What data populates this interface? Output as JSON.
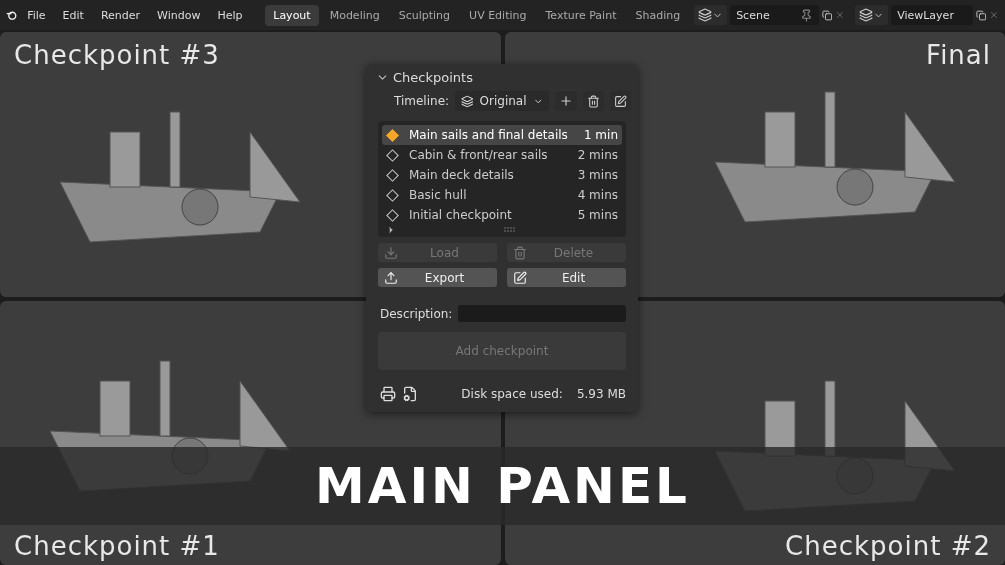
{
  "menu": [
    "File",
    "Edit",
    "Render",
    "Window",
    "Help"
  ],
  "workspaces": [
    {
      "label": "Layout",
      "selected": true
    },
    {
      "label": "Modeling",
      "selected": false
    },
    {
      "label": "Sculpting",
      "selected": false
    },
    {
      "label": "UV Editing",
      "selected": false
    },
    {
      "label": "Texture Paint",
      "selected": false
    },
    {
      "label": "Shading",
      "selected": false
    }
  ],
  "scene": "Scene",
  "view_layer": "ViewLayer",
  "viewports": [
    {
      "label": "Checkpoint #3"
    },
    {
      "label": "Final"
    },
    {
      "label": "Checkpoint #1"
    },
    {
      "label": "Checkpoint #2"
    }
  ],
  "panel": {
    "title": "Checkpoints",
    "timeline_label": "Timeline:",
    "timeline_value": "Original",
    "checkpoints": [
      {
        "name": "Main sails and final details",
        "time": "1 min",
        "selected": true
      },
      {
        "name": "Cabin & front/rear sails",
        "time": "2 mins",
        "selected": false
      },
      {
        "name": "Main deck details",
        "time": "3 mins",
        "selected": false
      },
      {
        "name": "Basic hull",
        "time": "4 mins",
        "selected": false
      },
      {
        "name": "Initial checkpoint",
        "time": "5 mins",
        "selected": false
      }
    ],
    "actions": [
      {
        "kind": "load",
        "label": "Load",
        "disabled": true
      },
      {
        "kind": "delete",
        "label": "Delete",
        "disabled": true
      },
      {
        "kind": "export",
        "label": "Export",
        "disabled": false
      },
      {
        "kind": "edit",
        "label": "Edit",
        "disabled": false
      }
    ],
    "description_label": "Description:",
    "add_button": {
      "label": "Add checkpoint",
      "disabled": true
    },
    "disk_label": "Disk space used:",
    "disk_value": "5.93 MB"
  },
  "banner": "MAIN PANEL"
}
